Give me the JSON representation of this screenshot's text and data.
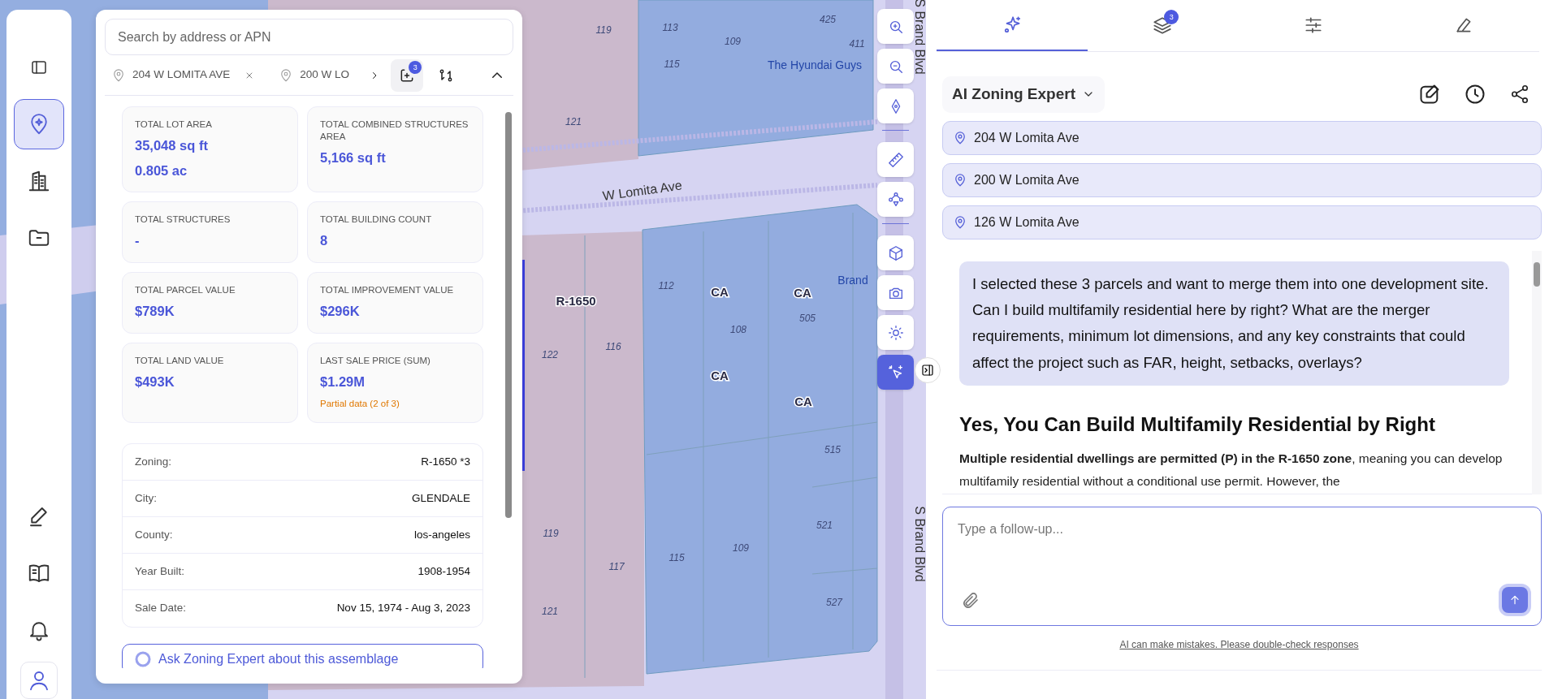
{
  "nav_rail": {
    "top_items": [
      {
        "selected": false
      },
      {
        "selected": true
      },
      {
        "selected": false
      },
      {
        "selected": false
      }
    ],
    "bottom_items": [
      {
        "selected": false
      },
      {
        "selected": false
      },
      {
        "selected": false
      },
      {
        "selected": true
      }
    ]
  },
  "map": {
    "labels": [
      {
        "kind": "lot",
        "text": "119"
      },
      {
        "kind": "lot",
        "text": "113"
      },
      {
        "kind": "lot",
        "text": "109"
      },
      {
        "kind": "lot",
        "text": "425"
      },
      {
        "kind": "lot",
        "text": "411"
      },
      {
        "kind": "lot",
        "text": "115"
      },
      {
        "kind": "poi",
        "text": "The Hyundai Guys"
      },
      {
        "kind": "lot",
        "text": "121"
      },
      {
        "kind": "street",
        "text": "W Lomita Ave"
      },
      {
        "kind": "lot",
        "text": "112"
      },
      {
        "kind": "zone",
        "text": "CA"
      },
      {
        "kind": "zone",
        "text": "CA"
      },
      {
        "kind": "zone",
        "text": "R-1650"
      },
      {
        "kind": "poi",
        "text": "Brand"
      },
      {
        "kind": "lot",
        "text": "505"
      },
      {
        "kind": "lot",
        "text": "108"
      },
      {
        "kind": "lot",
        "text": "122"
      },
      {
        "kind": "lot",
        "text": "116"
      },
      {
        "kind": "zone",
        "text": "CA"
      },
      {
        "kind": "zone",
        "text": "CA"
      },
      {
        "kind": "lot",
        "text": "515"
      },
      {
        "kind": "lot",
        "text": "521"
      },
      {
        "kind": "lot",
        "text": "119"
      },
      {
        "kind": "lot",
        "text": "115"
      },
      {
        "kind": "lot",
        "text": "109"
      },
      {
        "kind": "lot",
        "text": "117"
      },
      {
        "kind": "lot",
        "text": "121"
      },
      {
        "kind": "lot",
        "text": "527"
      },
      {
        "kind": "street",
        "text": "S Brand Blvd"
      },
      {
        "kind": "street",
        "text": "S Brand Blvd"
      }
    ]
  },
  "map_controls": [
    {
      "selected": false
    },
    {
      "selected": false
    },
    {
      "selected": false
    },
    {
      "selected": false
    },
    {
      "selected": false
    },
    {
      "selected": false
    },
    {
      "selected": false
    },
    {
      "selected": false
    },
    {
      "selected": true
    }
  ],
  "panel": {
    "search": {
      "placeholder": "Search by address or APN"
    },
    "chips": [
      {
        "label": "204 W LOMITA AVE",
        "removable": true
      },
      {
        "label": "200 W LO",
        "removable": false
      }
    ],
    "assemblage": {
      "badge": "3",
      "selected": true
    },
    "stats": [
      {
        "label": "TOTAL LOT AREA",
        "values": [
          "35,048 sq ft",
          "0.805 ac"
        ]
      },
      {
        "label": "TOTAL COMBINED STRUCTURES AREA",
        "values": [
          "5,166 sq ft"
        ]
      },
      {
        "label": "TOTAL STRUCTURES",
        "values": [
          "-"
        ]
      },
      {
        "label": "TOTAL BUILDING COUNT",
        "values": [
          "8"
        ]
      },
      {
        "label": "TOTAL PARCEL VALUE",
        "values": [
          "$789K"
        ]
      },
      {
        "label": "TOTAL IMPROVEMENT VALUE",
        "values": [
          "$296K"
        ]
      },
      {
        "label": "TOTAL LAND VALUE",
        "values": [
          "$493K"
        ]
      },
      {
        "label": "LAST SALE PRICE (SUM)",
        "values": [
          "$1.29M"
        ],
        "note": "Partial data (2 of 3)"
      }
    ],
    "details": [
      {
        "label": "Zoning:",
        "value": "R-1650 *3"
      },
      {
        "label": "City:",
        "value": "GLENDALE"
      },
      {
        "label": "County:",
        "value": "los-angeles"
      },
      {
        "label": "Year Built:",
        "value": "1908-1954"
      },
      {
        "label": "Sale Date:",
        "value": "Nov 15, 1974 - Aug 3, 2023"
      }
    ],
    "ask_button": "Ask Zoning Expert about this assemblage"
  },
  "assistant": {
    "tabs": [
      {
        "selected": true
      },
      {
        "selected": false,
        "badge": "3"
      },
      {
        "selected": false
      },
      {
        "selected": false
      }
    ],
    "title": "AI Zoning Expert",
    "addresses": [
      "204 W Lomita Ave",
      "200 W Lomita Ave",
      "126 W Lomita Ave"
    ],
    "user_message": "I selected these 3 parcels and want to merge them into one development site. Can I build multifamily residential here by right? What are the merger requirements, minimum lot dimensions, and any key constraints that could affect the project such as FAR, height, setbacks, overlays?",
    "response_heading": "Yes, You Can Build Multifamily Residential by Right",
    "response_text": "**Multiple residential dwellings are permitted (P) in the R-1650 zone**, meaning you can develop multifamily residential without a conditional use permit. However, the",
    "input": {
      "placeholder": "Type a follow-up..."
    },
    "disclaimer": "AI can make mistakes. Please double-check responses"
  }
}
